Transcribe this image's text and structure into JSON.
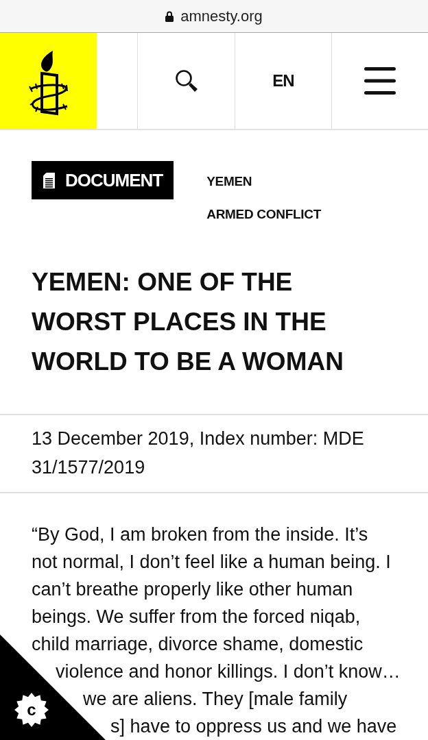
{
  "browser_bar": {
    "address": "amnesty.org"
  },
  "header": {
    "language": "EN"
  },
  "content_type": {
    "label": "DOCUMENT"
  },
  "topics": [
    "YEMEN",
    "ARMED CONFLICT"
  ],
  "title": "YEMEN: ONE OF THE WORST PLACES IN THE WORLD TO BE A WOMAN",
  "meta": "13 December 2019, Index number: MDE 31/1577/2019",
  "quote_lines": [
    "“By God, I am broken from the inside. It’s",
    "not normal, I don’t feel like a human being. I",
    "can’t breathe properly like other human",
    "beings. We suffer from the forced niqab,",
    "child marriage, divorce shame, domestic",
    "violence and honor killings. I don’t know…",
    "we are aliens. They [male family",
    "s] have to oppress us and we have"
  ],
  "corner_badge": {
    "letter": "c"
  }
}
